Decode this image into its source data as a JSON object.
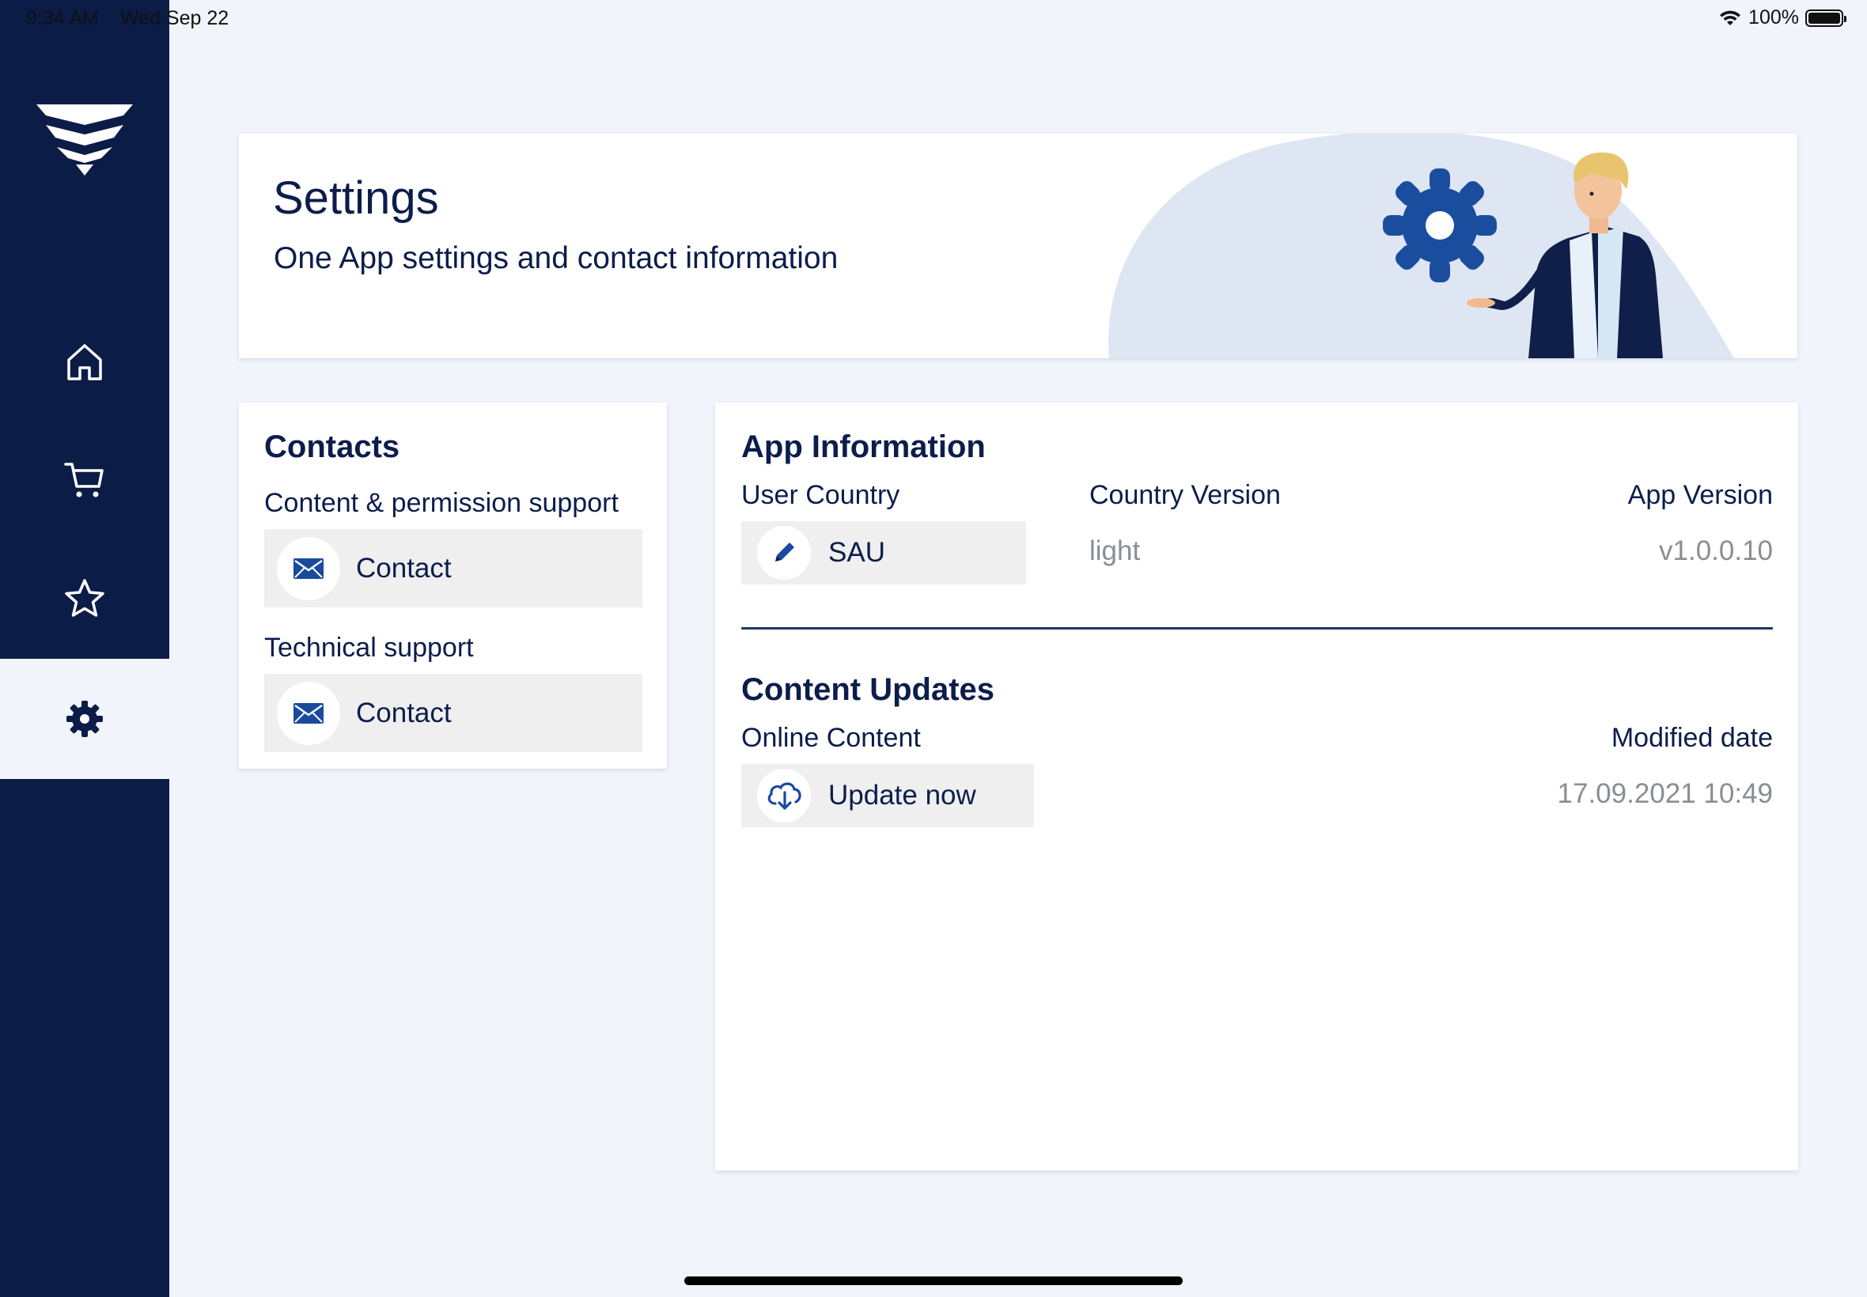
{
  "status_bar": {
    "time": "9:34 AM",
    "date": "Wed Sep 22",
    "battery": "100%",
    "icons": [
      "wifi-icon",
      "battery-icon"
    ]
  },
  "sidebar": {
    "logo": "brand-logo",
    "items": [
      {
        "name": "home",
        "icon": "home-icon",
        "active": false
      },
      {
        "name": "cart",
        "icon": "cart-icon",
        "active": false
      },
      {
        "name": "favorites",
        "icon": "star-icon",
        "active": false
      },
      {
        "name": "settings",
        "icon": "gear-icon",
        "active": true
      }
    ]
  },
  "header": {
    "title": "Settings",
    "subtitle": "One App settings and contact information"
  },
  "contacts": {
    "title": "Contacts",
    "groups": [
      {
        "label": "Content & permission support",
        "button_label": "Contact",
        "icon": "mail-icon"
      },
      {
        "label": "Technical support",
        "button_label": "Contact",
        "icon": "mail-icon"
      }
    ]
  },
  "app_info": {
    "title": "App Information",
    "user_country_label": "User Country",
    "user_country_value": "SAU",
    "country_version_label": "Country Version",
    "country_version_value": "light",
    "app_version_label": "App Version",
    "app_version_value": "v1.0.0.10"
  },
  "content_updates": {
    "title": "Content Updates",
    "online_content_label": "Online Content",
    "update_button_label": "Update now",
    "modified_date_label": "Modified date",
    "modified_date_value": "17.09.2021 10:49"
  },
  "colors": {
    "sidebar_bg": "#0b1c47",
    "page_bg": "#f1f4fb",
    "accent": "#1a4a9e",
    "text_primary": "#0b1d4a",
    "text_muted": "#8a8d93",
    "button_bg": "#efefef"
  }
}
